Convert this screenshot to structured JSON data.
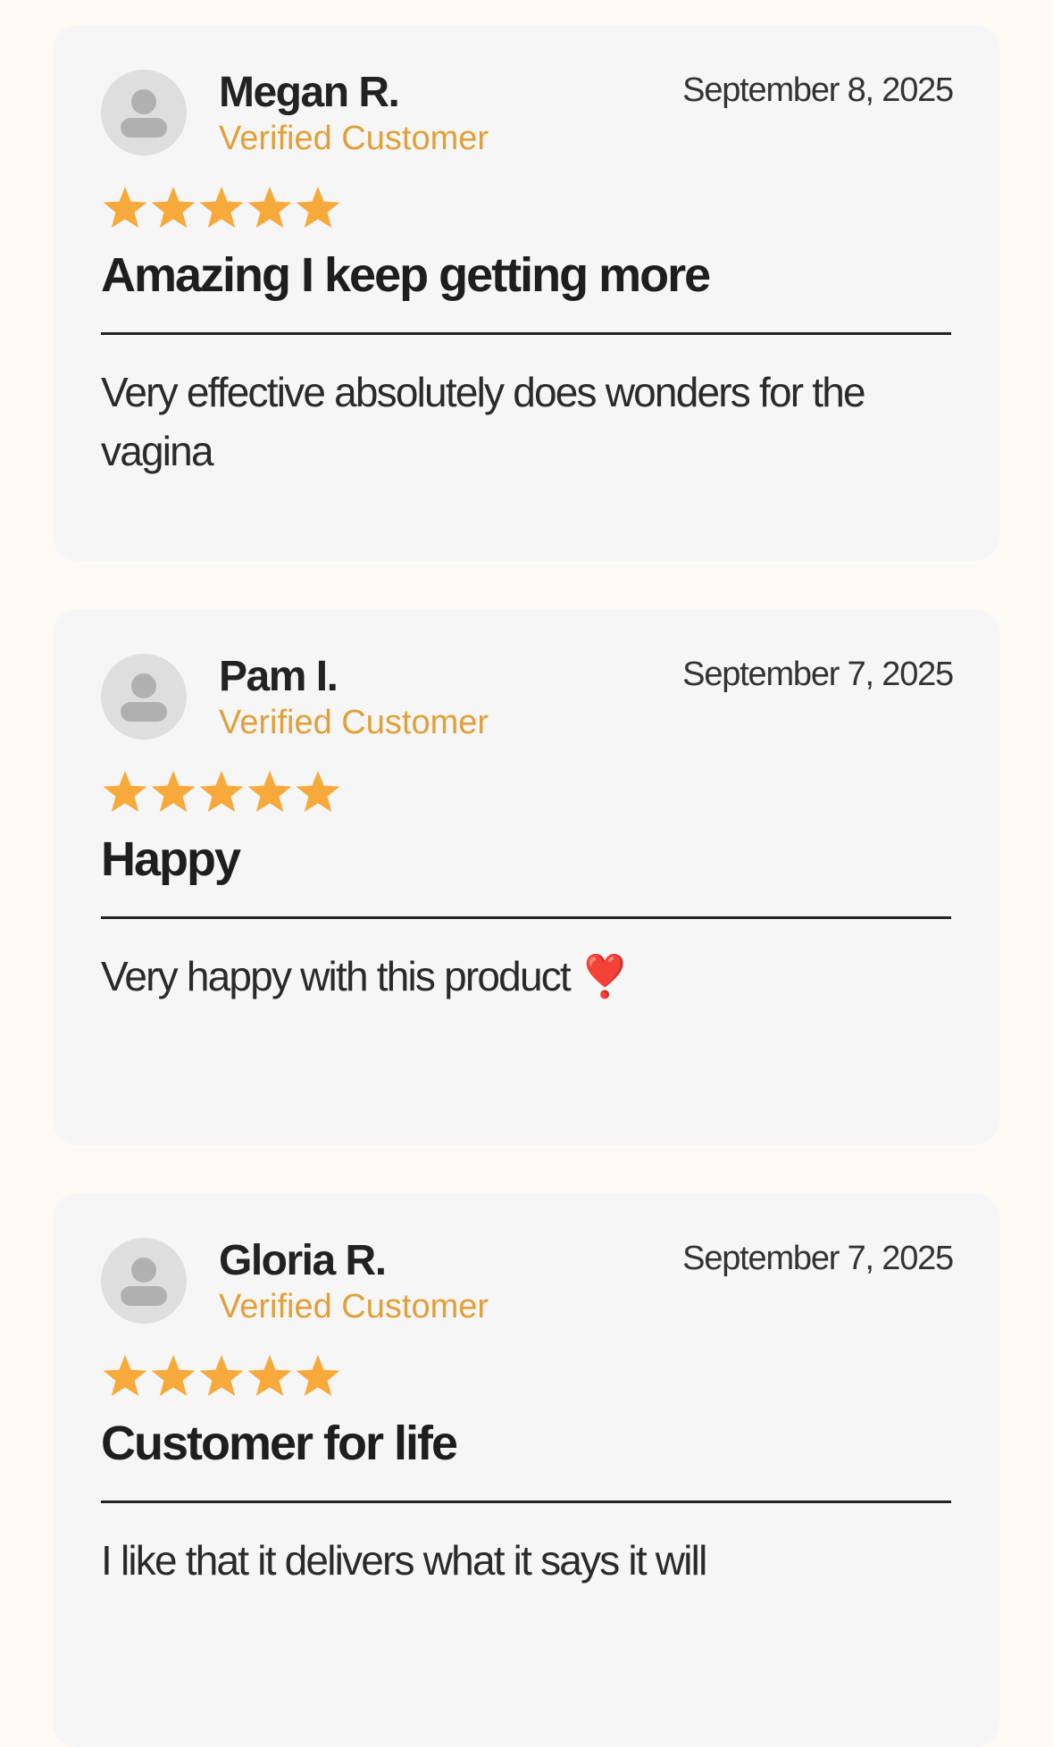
{
  "colors": {
    "page_background": "#fdf9f5",
    "card_background": "#f6f6f6",
    "verified_text": "#e0a03a",
    "star_fill": "#f8a93b",
    "avatar_background": "#dedede",
    "avatar_silhouette": "#b0b0b0"
  },
  "reviews": [
    {
      "reviewer_name": "Megan R.",
      "badge": "Verified Customer",
      "date": "September 8, 2025",
      "rating": 5,
      "rating_max": 5,
      "title": "Amazing I keep getting more",
      "body": "Very effective absolutely does wonders for the vagina",
      "avatar_icon": "person-silhouette-icon"
    },
    {
      "reviewer_name": "Pam I.",
      "badge": "Verified Customer",
      "date": "September 7, 2025",
      "rating": 5,
      "rating_max": 5,
      "title": "Happy",
      "body": "Very happy with this product ❣️",
      "avatar_icon": "person-silhouette-icon"
    },
    {
      "reviewer_name": "Gloria R.",
      "badge": "Verified Customer",
      "date": "September 7, 2025",
      "rating": 5,
      "rating_max": 5,
      "title": "Customer for life",
      "body": "I like that it delivers what it says it will",
      "avatar_icon": "person-silhouette-icon"
    }
  ]
}
